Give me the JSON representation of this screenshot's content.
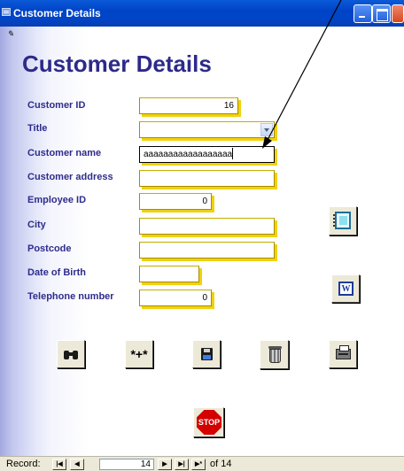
{
  "window": {
    "title": "Customer Details"
  },
  "form": {
    "title": "Customer Details",
    "fields": {
      "customer_id": {
        "label": "Customer ID",
        "value": "16"
      },
      "title": {
        "label": "Title",
        "value": ""
      },
      "customer_name": {
        "label": "Customer name",
        "value": "aaaaaaaaaaaaaaaaaa"
      },
      "customer_address": {
        "label": "Customer address",
        "value": ""
      },
      "employee_id": {
        "label": "Employee ID",
        "value": "0"
      },
      "city": {
        "label": "City",
        "value": ""
      },
      "postcode": {
        "label": "Postcode",
        "value": ""
      },
      "date_of_birth": {
        "label": "Date of Birth",
        "value": ""
      },
      "telephone_number": {
        "label": "Telephone number",
        "value": "0"
      }
    },
    "buttons": {
      "find": {
        "icon": "binoculars-icon"
      },
      "new_record": {
        "icon": "new-record-icon",
        "glyph": "*+*"
      },
      "save": {
        "icon": "save-disk-icon"
      },
      "delete": {
        "icon": "trash-bin-icon"
      },
      "print": {
        "icon": "printer-icon"
      },
      "notebook": {
        "icon": "notebook-icon"
      },
      "word": {
        "icon": "word-icon",
        "glyph": "W"
      },
      "stop": {
        "icon": "stop-sign-icon",
        "glyph": "STOP"
      }
    }
  },
  "navigation": {
    "label": "Record:",
    "current": "14",
    "of_text": "of 14",
    "buttons": {
      "first": "|◀",
      "prev": "◀",
      "next": "▶",
      "last": "▶|",
      "new": "▶*"
    }
  },
  "colors": {
    "title_text": "#2d2a8a",
    "label_text": "#2e2c8c",
    "field_shadow": "#f0d20e",
    "titlebar": "#0044c8",
    "stop": "#d40000"
  }
}
